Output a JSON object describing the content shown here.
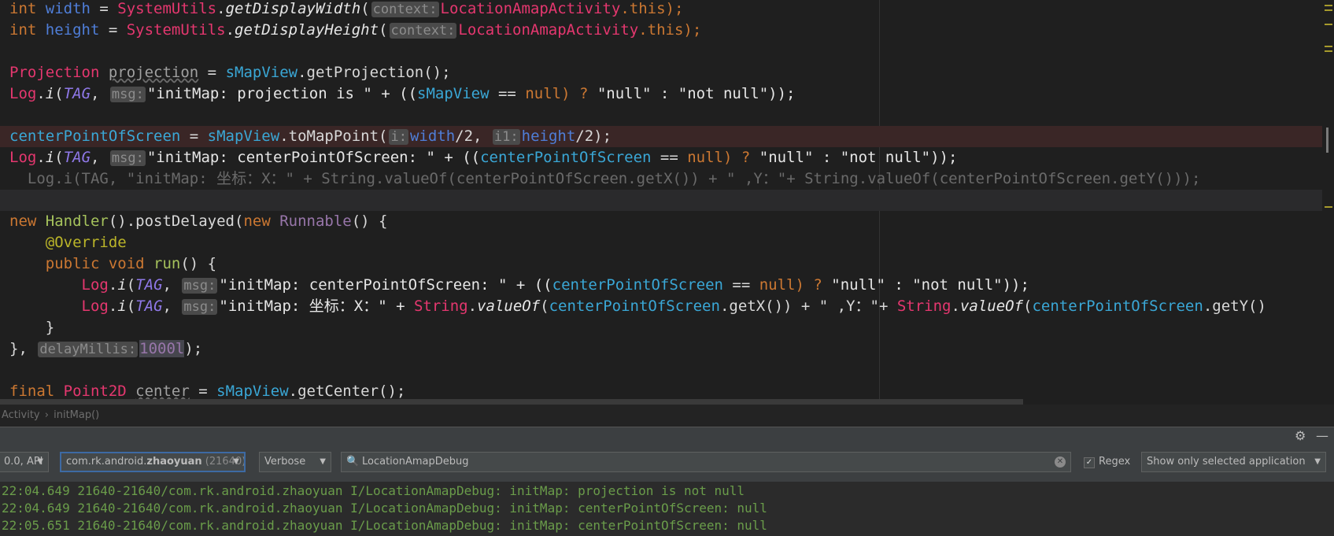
{
  "editor": {
    "l1": {
      "a": "int ",
      "b": "width",
      "c": " = ",
      "d": "SystemUtils",
      "e": ".",
      "f": "getDisplayWidth",
      "g": "(",
      "hint": "context:",
      "h": "LocationAmapActivity",
      "i": ".this);"
    },
    "l2": {
      "a": "int ",
      "b": "height",
      "c": " = ",
      "d": "SystemUtils",
      "e": ".",
      "f": "getDisplayHeight",
      "g": "(",
      "hint": "context:",
      "h": "LocationAmapActivity",
      "i": ".this);"
    },
    "l4": {
      "a": "Projection",
      "b": " ",
      "c": "projection",
      "d": " = ",
      "e": "sMapView",
      "f": ".getProjection();"
    },
    "l5": {
      "a": "Log",
      "b": ".",
      "c": "i",
      "d": "(",
      "e": "TAG",
      "f": ", ",
      "hint": "msg:",
      "g": "\"initMap: projection is \" + ((",
      "h": "sMapView",
      "i": " == ",
      "j": "null",
      "k": ") ? ",
      "l": "\"null\" : \"not null\"));"
    },
    "l7": {
      "a": "centerPointOfScreen",
      "b": " = ",
      "c": "sMapView",
      "d": ".toMapPoint(",
      "hint1": "i:",
      "e": "width",
      "f": "/2, ",
      "hint2": "i1:",
      "g": "height",
      "h": "/2);"
    },
    "l8": {
      "a": "Log",
      "b": ".",
      "c": "i",
      "d": "(",
      "e": "TAG",
      "f": ", ",
      "hint": "msg:",
      "g": "\"initMap: centerPointOfScreen: \" + ((",
      "h": "centerPointOfScreen",
      "i": " == ",
      "j": "null",
      "k": ") ? ",
      "l": "\"null\" : \"not null\"));"
    },
    "l9": {
      "text": "  Log.i(TAG, \"initMap: 坐标：X：\" + String.valueOf(centerPointOfScreen.getX()) + \" ,Y：\"+ String.valueOf(centerPointOfScreen.getY()));"
    },
    "l11": {
      "a": "new ",
      "b": "Handler",
      "c": "().postDelayed(",
      "d": "new ",
      "e": "Runnable",
      "f": "() {"
    },
    "l12": {
      "a": "    @Override"
    },
    "l13": {
      "a": "    public void ",
      "b": "run",
      "c": "() {"
    },
    "l14": {
      "a": "        Log",
      "b": ".",
      "c": "i",
      "d": "(",
      "e": "TAG",
      "f": ", ",
      "hint": "msg:",
      "g": "\"initMap: centerPointOfScreen: \" + ((",
      "h": "centerPointOfScreen",
      "i": " == ",
      "j": "null",
      "k": ") ? ",
      "l": "\"null\" : \"not null\"));"
    },
    "l15": {
      "a": "        Log",
      "b": ".",
      "c": "i",
      "d": "(",
      "e": "TAG",
      "f": ", ",
      "hint": "msg:",
      "g": "\"initMap: 坐标：X：\" + ",
      "h": "String",
      "i": ".",
      "j": "valueOf",
      "k": "(",
      "l": "centerPointOfScreen",
      "m": ".getX()) + \" ,Y：\"+ ",
      "n": "String",
      "o": ".",
      "p": "valueOf",
      "q": "(",
      "r": "centerPointOfScreen",
      "s": ".getY()"
    },
    "l16": {
      "a": "    }"
    },
    "l17": {
      "a": "}, ",
      "hint": "delayMillis:",
      "b": "1000l",
      "c": ");"
    },
    "l19": {
      "a": "final ",
      "b": "Point2D",
      "c": " ",
      "d": "center",
      "e": " = ",
      "f": "sMapView",
      "g": ".getCenter();"
    }
  },
  "breadcrumb": {
    "class": "Activity",
    "sep": "›",
    "method": "initMap()"
  },
  "toolbar": {
    "device": "0.0, API",
    "process_prefix": "com.rk.android.",
    "process_bold": "zhaoyuan",
    "process_suffix": " (21640) [",
    "level": "Verbose",
    "search_value": "LocationAmapDebug",
    "regex_label": "Regex",
    "filter": "Show only selected application"
  },
  "log": [
    "22:04.649 21640-21640/com.rk.android.zhaoyuan I/LocationAmapDebug: initMap: projection is not null",
    "22:04.649 21640-21640/com.rk.android.zhaoyuan I/LocationAmapDebug: initMap: centerPointOfScreen: null",
    "22:05.651 21640-21640/com.rk.android.zhaoyuan I/LocationAmapDebug: initMap: centerPointOfScreen: null"
  ],
  "colors": {
    "background": "#1f1f1f",
    "keyword": "#cc7832",
    "field": "#4f7ed8",
    "class": "#e5376f",
    "log": "#6a9c4a"
  }
}
